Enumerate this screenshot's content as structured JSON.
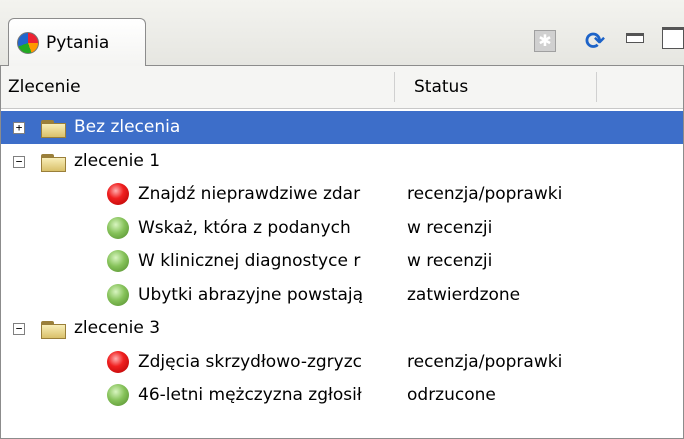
{
  "view": {
    "tab_title": "Pytania",
    "toolbar": {
      "collapse_icon": "collapse-all-icon",
      "refresh_icon": "refresh-icon",
      "minimize_icon": "minimize-icon",
      "maximize_icon": "maximize-icon"
    }
  },
  "table": {
    "columns": [
      "Zlecenie",
      "Status"
    ],
    "rows": [
      {
        "type": "group",
        "expander": "+",
        "label": "Bez zlecenia",
        "selected": true
      },
      {
        "type": "group",
        "expander": "−",
        "label": "zlecenie 1",
        "selected": false
      },
      {
        "type": "item",
        "status_icon": "red",
        "label": "Znajdź nieprawdziwe zdar",
        "status": "recenzja/poprawki"
      },
      {
        "type": "item",
        "status_icon": "green",
        "label": "Wskaż, która z podanych",
        "status": "w recenzji"
      },
      {
        "type": "item",
        "status_icon": "green",
        "label": "W klinicznej diagnostyce r",
        "status": "w recenzji"
      },
      {
        "type": "item",
        "status_icon": "green",
        "label": "Ubytki abrazyjne powstają",
        "status": "zatwierdzone"
      },
      {
        "type": "group",
        "expander": "−",
        "label": "zlecenie 3",
        "selected": false
      },
      {
        "type": "item",
        "status_icon": "red",
        "label": "Zdjęcia skrzydłowo-zgryzc",
        "status": "recenzja/poprawki"
      },
      {
        "type": "item",
        "status_icon": "green",
        "label": "46-letni mężczyzna zgłosił",
        "status": "odrzucone"
      }
    ]
  },
  "colors": {
    "selection": "#3d6ec9",
    "status_red": "#f02020",
    "status_green": "#86c25a"
  }
}
